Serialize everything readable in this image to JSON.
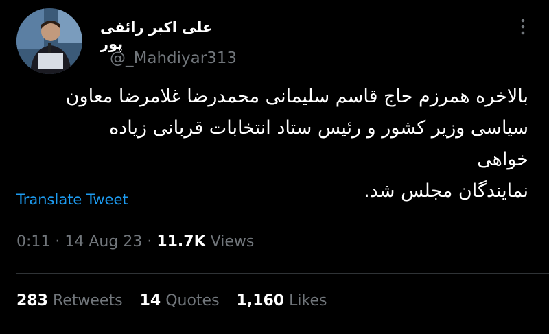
{
  "author": {
    "name": "علی اکبر رائفی پور",
    "handle": "@_Mahdiyar313"
  },
  "tweet": {
    "text_lines": [
      "بالاخره همرزم حاج قاسم سلیمانی محمدرضا غلامرضا معاون",
      "سیاسی وزیر کشور  و رئیس ستاد انتخابات قربانی زیاده خواهی",
      "نمایندگان مجلس شد."
    ],
    "translate_label": "Translate Tweet",
    "time": "0:11",
    "date": "14 Aug 23",
    "views_count": "11.7K",
    "views_label": "Views",
    "separator": " · "
  },
  "stats": {
    "retweets_count": "283",
    "retweets_label": "Retweets",
    "quotes_count": "14",
    "quotes_label": "Quotes",
    "likes_count": "1,160",
    "likes_label": "Likes"
  },
  "icons": {
    "more": "more-vertical-icon",
    "avatar": "profile-photo"
  },
  "colors": {
    "background": "#000000",
    "text": "#ffffff",
    "secondary": "#71767b",
    "link": "#1d9bf0",
    "divider": "#2f3336"
  }
}
